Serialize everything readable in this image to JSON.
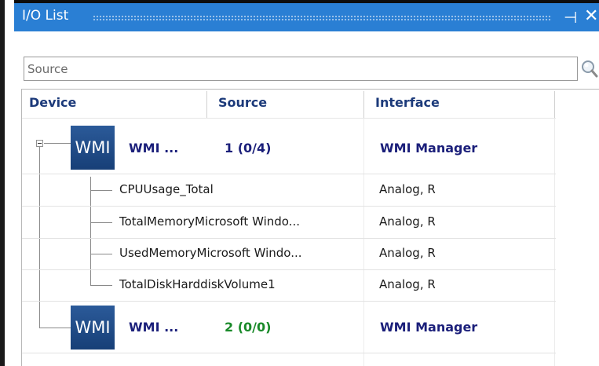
{
  "panel": {
    "title": "I/O List"
  },
  "search": {
    "placeholder": "Source",
    "value": ""
  },
  "columns": [
    "Device",
    "Source",
    "Interface"
  ],
  "devices": [
    {
      "logo": "WMI",
      "name": "WMI ...",
      "source": "1 (0/4)",
      "interface": "WMI Manager",
      "expanded": true,
      "source_color": "#1b1f7a",
      "channels": [
        {
          "name": "CPUUsage_Total",
          "interface": "Analog, R"
        },
        {
          "name": "TotalMemoryMicrosoft Windo...",
          "interface": "Analog, R"
        },
        {
          "name": "UsedMemoryMicrosoft Windo...",
          "interface": "Analog, R"
        },
        {
          "name": "TotalDiskHarddiskVolume1",
          "interface": "Analog, R"
        }
      ]
    },
    {
      "logo": "WMI",
      "name": "WMI ...",
      "source": "2 (0/0)",
      "interface": "WMI Manager",
      "expanded": false,
      "source_color": "#1a8a2a",
      "channels": []
    }
  ],
  "icons": {
    "pin": "pin-icon",
    "close": "close-icon",
    "search": "magnifier-icon",
    "expander": "collapse-icon"
  },
  "colors": {
    "titlebar": "#2a7fd4",
    "header_text": "#1c3a7a",
    "device_text": "#1b1f7a",
    "ok_green": "#1a8a2a"
  }
}
